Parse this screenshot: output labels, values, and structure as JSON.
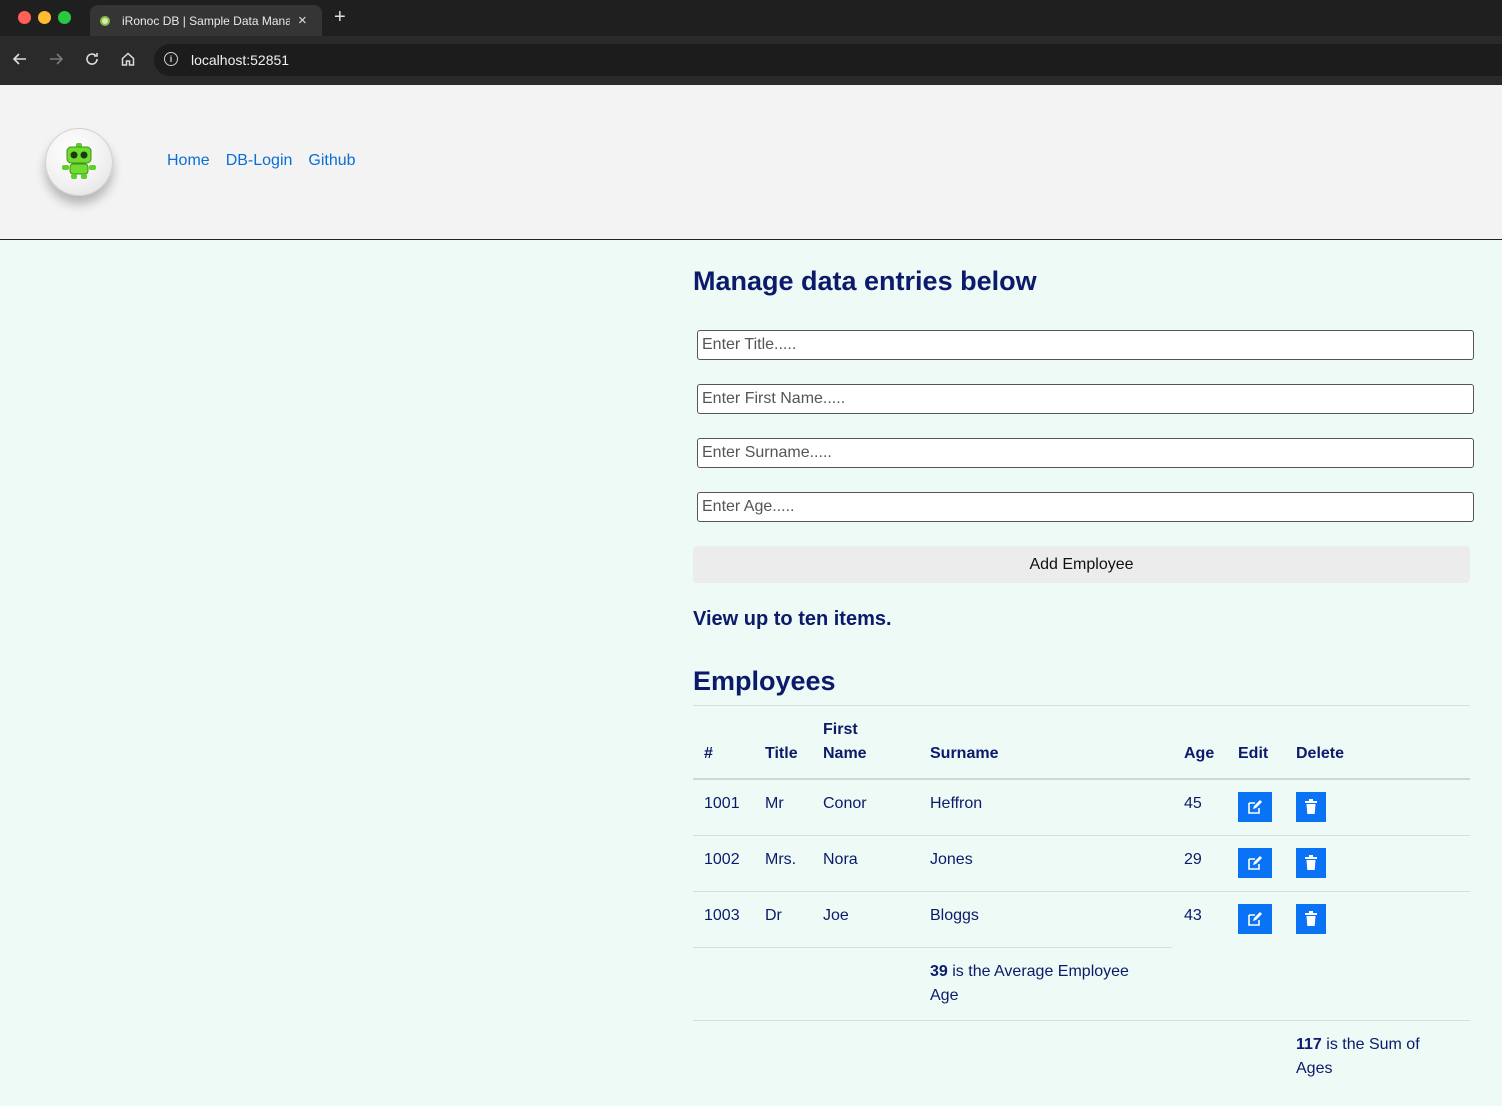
{
  "browser": {
    "tab_title": "iRonoc DB | Sample Data Manager",
    "tab_close": "×",
    "new_tab": "+",
    "url": "localhost:52851"
  },
  "nav": {
    "links": [
      {
        "label": "Home"
      },
      {
        "label": "DB-Login"
      },
      {
        "label": "Github"
      }
    ]
  },
  "main": {
    "title": "Manage data entries below",
    "inputs": {
      "title_placeholder": "Enter Title.....",
      "firstname_placeholder": "Enter First Name.....",
      "surname_placeholder": "Enter Surname.....",
      "age_placeholder": "Enter Age....."
    },
    "add_button": "Add Employee",
    "view_link": "View up to ten items.",
    "employees_heading": "Employees"
  },
  "table": {
    "headers": {
      "id": "#",
      "title": "Title",
      "first_name_line1": "First",
      "first_name_line2": "Name",
      "surname": "Surname",
      "age": "Age",
      "edit": "Edit",
      "delete": "Delete"
    },
    "rows": [
      {
        "id": "1001",
        "title": "Mr",
        "first_name": "Conor",
        "surname": "Heffron",
        "age": "45"
      },
      {
        "id": "1002",
        "title": "Mrs.",
        "first_name": "Nora",
        "surname": "Jones",
        "age": "29"
      },
      {
        "id": "1003",
        "title": "Dr",
        "first_name": "Joe",
        "surname": "Bloggs",
        "age": "43"
      }
    ],
    "average_value": "39",
    "average_text_line1": " is the Average Employee",
    "average_text_line2": "Age",
    "sum_value": "117",
    "sum_text_line1": " is the Sum of",
    "sum_text_line2": "Ages"
  },
  "colors": {
    "accent_button": "#0a72f5",
    "nav_link": "#0a6fd6",
    "text": "#0b1a6b",
    "page_bg": "#eefaf5"
  }
}
